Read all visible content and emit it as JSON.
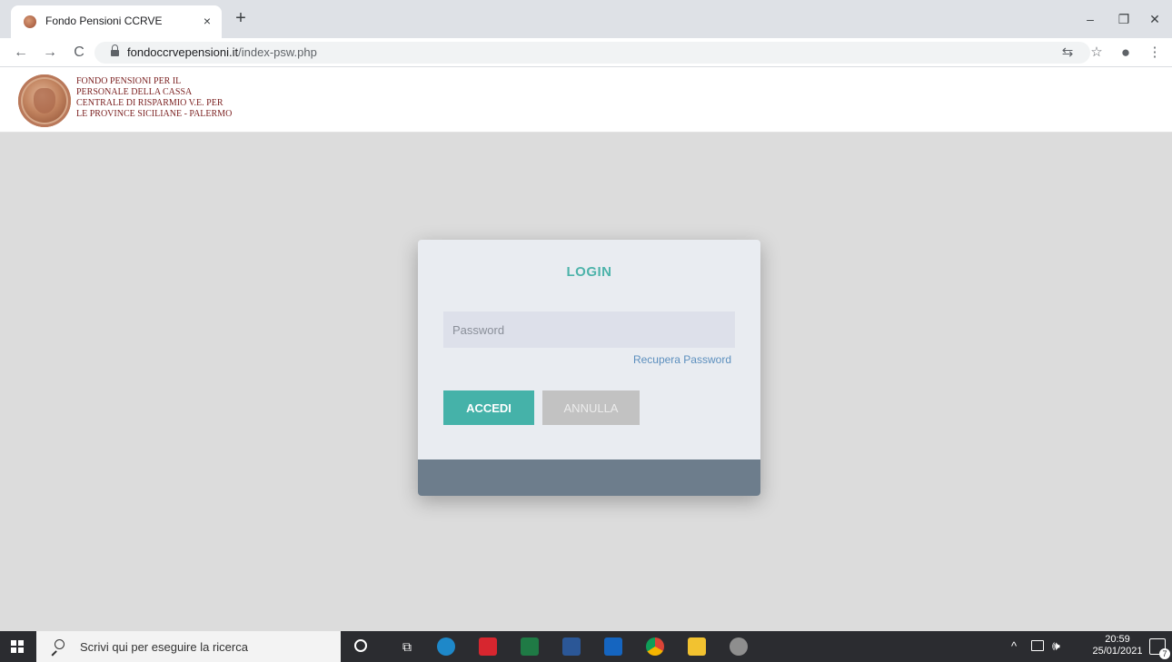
{
  "browser": {
    "tab_title": "Fondo Pensioni CCRVE",
    "tab_close": "×",
    "new_tab": "+",
    "window_controls": {
      "minimize": "–",
      "restore": "❐",
      "close": "✕"
    },
    "nav": {
      "back": "←",
      "forward": "→",
      "reload": "C"
    },
    "url_domain": "fondoccrvepensioni.it",
    "url_path": "/index-psw.php",
    "toolbar_icons": {
      "translate": "⇆",
      "bookmark": "☆",
      "profile": "●",
      "menu": "⋮"
    }
  },
  "site": {
    "name_lines": [
      "FONDO PENSIONI  PER IL",
      "PERSONALE DELLA CASSA",
      "CENTRALE DI RISPARMIO V.E. PER",
      "LE PROVINCE SICILIANE - PALERMO"
    ]
  },
  "login": {
    "title": "LOGIN",
    "password_placeholder": "Password",
    "recover_link": "Recupera Password",
    "submit_label": "ACCEDI",
    "cancel_label": "ANNULLA"
  },
  "taskbar": {
    "search_placeholder": "Scrivi qui per eseguire la ricerca",
    "tray_arrow": "^",
    "tray_volume": "🕪",
    "time": "20:59",
    "date": "25/01/2021",
    "notification_count": "7",
    "apps": [
      {
        "name": "edge",
        "color": "#1e88c9"
      },
      {
        "name": "acrobat",
        "color": "#d7262f"
      },
      {
        "name": "excel",
        "color": "#1f7a45"
      },
      {
        "name": "word",
        "color": "#2b5797"
      },
      {
        "name": "outlook",
        "color": "#1565c0"
      },
      {
        "name": "chrome",
        "color": "#e9a219"
      },
      {
        "name": "explorer",
        "color": "#f2c230"
      },
      {
        "name": "paint",
        "color": "#8e8e8e"
      }
    ]
  },
  "colors": {
    "accent_teal": "#45b2a9",
    "footer_slate": "#6d7d8c",
    "page_bg": "#dcdcdc"
  }
}
